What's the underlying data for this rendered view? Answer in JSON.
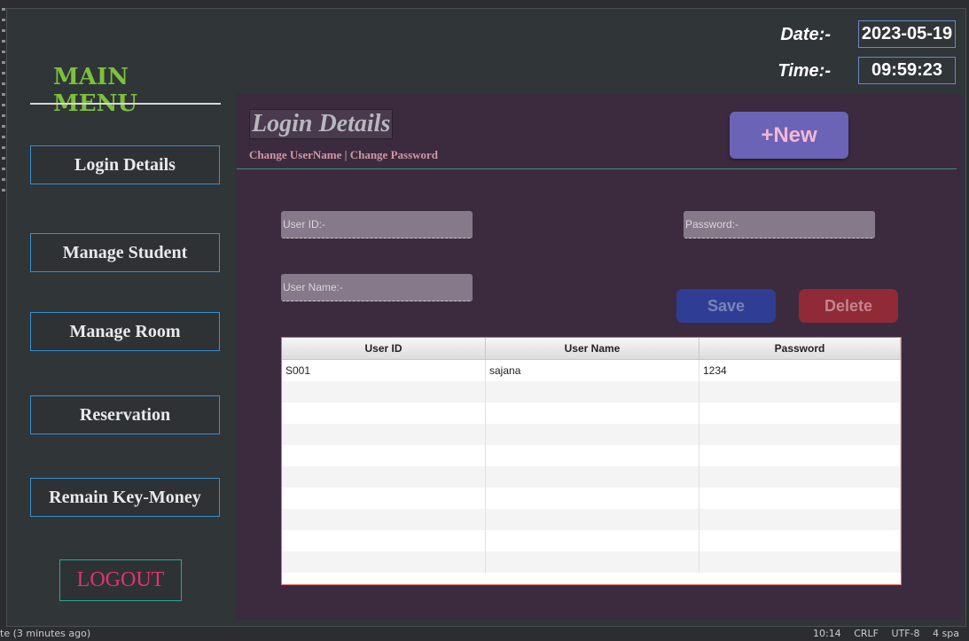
{
  "menu": {
    "title": "MAIN MENU",
    "items": [
      {
        "label": "Login Details"
      },
      {
        "label": "Manage Student"
      },
      {
        "label": "Manage Room"
      },
      {
        "label": "Reservation"
      },
      {
        "label": "Remain Key-Money"
      }
    ],
    "logout": "LOGOUT"
  },
  "header": {
    "date_label": "Date:-",
    "date_value": "2023-05-19",
    "time_label": "Time:-",
    "time_value": "09:59:23"
  },
  "content": {
    "title": "Login Details",
    "subtitle": "Change UserName | Change Password",
    "new_button": "+New",
    "fields": {
      "user_id_placeholder": "User ID:-",
      "password_placeholder": "Password:-",
      "user_name_placeholder": "User Name:-"
    },
    "save_button": "Save",
    "delete_button": "Delete",
    "table": {
      "columns": [
        "User ID",
        "User Name",
        "Password"
      ],
      "rows": [
        [
          "S001",
          "sajana",
          "1234"
        ]
      ]
    }
  },
  "statusbar": {
    "left": "te (3 minutes ago)",
    "position": "10:14",
    "line_ending": "CRLF",
    "encoding": "UTF-8",
    "indent": "4 spa"
  },
  "colors": {
    "menu_title": "#7cc13a",
    "nav_border": "#3a8fd0",
    "logout_text": "#e2336f",
    "content_bg": "#3c2b3f",
    "new_button": "#6b63b5",
    "save_button": "#2f3e94",
    "delete_button": "#8f2a36"
  }
}
